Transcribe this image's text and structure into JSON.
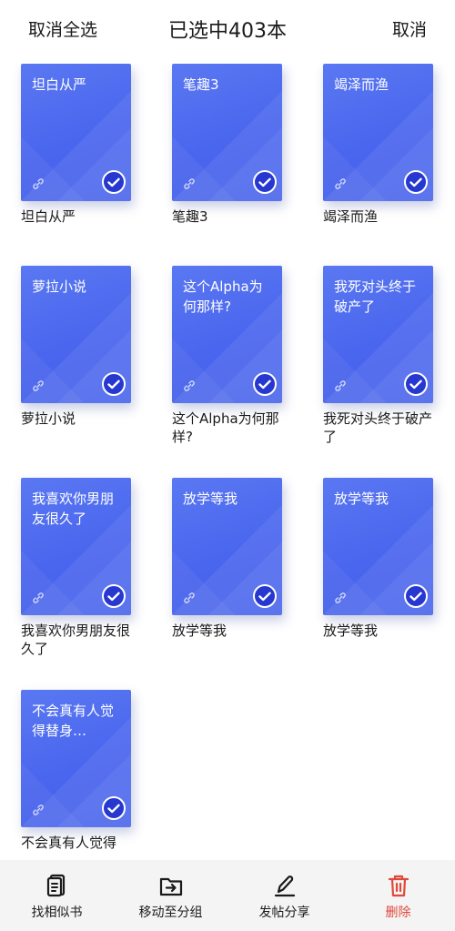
{
  "header": {
    "deselect_all": "取消全选",
    "title": "已选中403本",
    "cancel": "取消"
  },
  "books": [
    {
      "cover_title": "坦白从严",
      "name": "坦白从严",
      "selected": true
    },
    {
      "cover_title": "笔趣3",
      "name": "笔趣3",
      "selected": true
    },
    {
      "cover_title": "竭泽而渔",
      "name": "竭泽而渔",
      "selected": true
    },
    {
      "cover_title": "萝拉小说",
      "name": "萝拉小说",
      "selected": true
    },
    {
      "cover_title": "这个Alpha为何那样?",
      "name": "这个Alpha为何那样?",
      "selected": true
    },
    {
      "cover_title": "我死对头终于破产了",
      "name": "我死对头终于破产了",
      "selected": true
    },
    {
      "cover_title": "我喜欢你男朋友很久了",
      "name": "我喜欢你男朋友很久了",
      "selected": true
    },
    {
      "cover_title": "放学等我",
      "name": "放学等我",
      "selected": true
    },
    {
      "cover_title": "放学等我",
      "name": "放学等我",
      "selected": true
    },
    {
      "cover_title": "不会真有人觉得替身…",
      "name": "不会真有人觉得",
      "selected": true
    }
  ],
  "bottom_bar": {
    "find_similar": "找相似书",
    "move_to_group": "移动至分组",
    "post_share": "发帖分享",
    "delete": "删除"
  },
  "colors": {
    "cover": "#4a66ee",
    "check": "#2638cf",
    "danger": "#e0483a"
  }
}
